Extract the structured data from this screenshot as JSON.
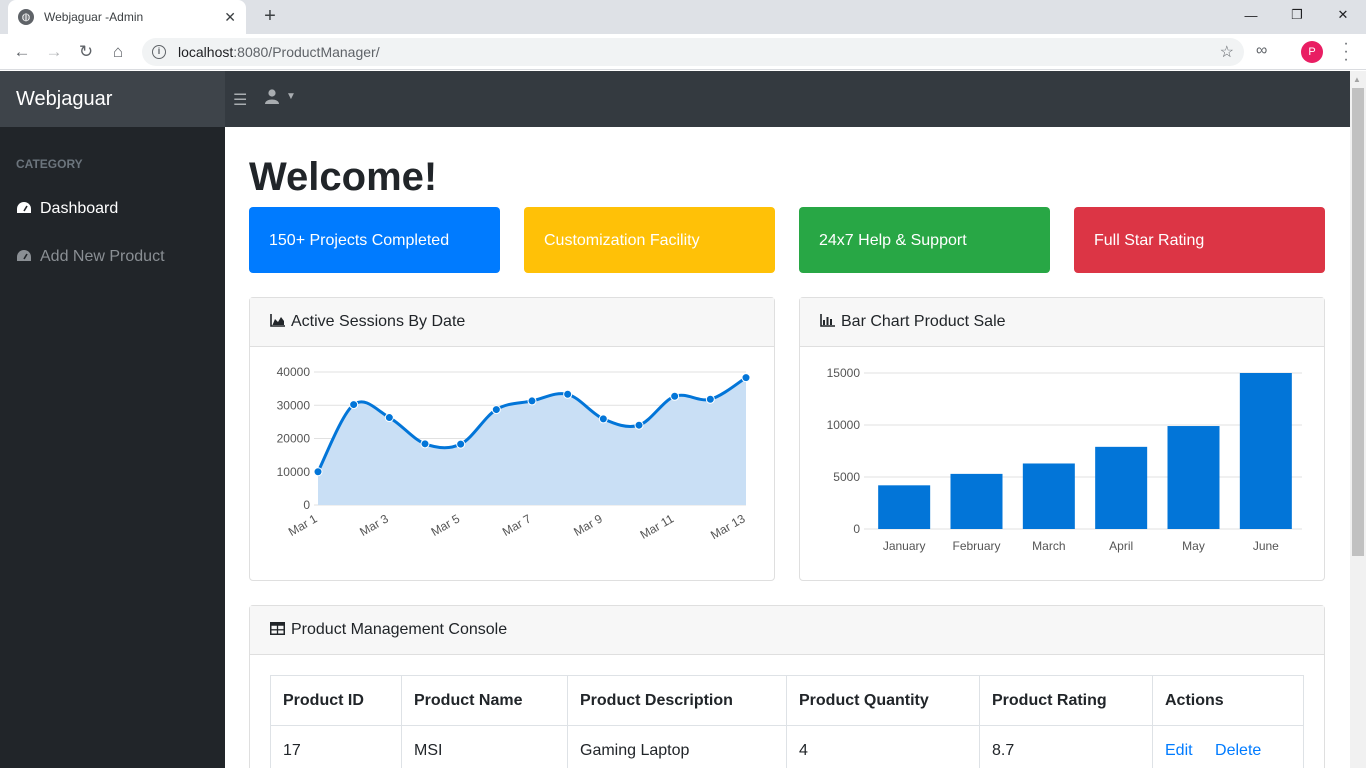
{
  "browser": {
    "tab_title": "Webjaguar -Admin",
    "url_host": "localhost",
    "url_rest": ":8080/ProductManager/",
    "profile_initial": "P"
  },
  "app": {
    "brand": "Webjaguar",
    "sidebar": {
      "heading": "CATEGORY",
      "items": [
        {
          "label": "Dashboard",
          "icon": "tachometer-icon"
        },
        {
          "label": "Add New Product",
          "icon": "tachometer-icon"
        }
      ]
    },
    "welcome": "Welcome!",
    "cards": [
      {
        "label": "150+ Projects Completed",
        "color": "#007bff"
      },
      {
        "label": "Customization Facility",
        "color": "#ffc107"
      },
      {
        "label": "24x7 Help & Support",
        "color": "#28a745"
      },
      {
        "label": "Full Star Rating",
        "color": "#dc3545"
      }
    ],
    "area_panel_title": "Active Sessions By Date",
    "bar_panel_title": "Bar Chart Product Sale",
    "table_panel_title": "Product Management Console",
    "table": {
      "headers": [
        "Product ID",
        "Product Name",
        "Product Description",
        "Product Quantity",
        "Product Rating",
        "Actions"
      ],
      "rows": [
        {
          "id": "17",
          "name": "MSI",
          "description": "Gaming Laptop",
          "quantity": "4",
          "rating": "8.7",
          "edit": "Edit",
          "delete": "Delete"
        }
      ]
    }
  },
  "chart_data": [
    {
      "type": "area",
      "title": "Active Sessions By Date",
      "x": [
        "Mar 1",
        "Mar 2",
        "Mar 3",
        "Mar 4",
        "Mar 5",
        "Mar 6",
        "Mar 7",
        "Mar 8",
        "Mar 9",
        "Mar 10",
        "Mar 11",
        "Mar 12",
        "Mar 13"
      ],
      "x_tick_labels": [
        "Mar 1",
        "Mar 3",
        "Mar 5",
        "Mar 7",
        "Mar 9",
        "Mar 11",
        "Mar 13"
      ],
      "values": [
        10000,
        30200,
        26300,
        18400,
        18300,
        28700,
        31300,
        33300,
        25900,
        24000,
        32700,
        31800,
        38300
      ],
      "y_ticks": [
        0,
        10000,
        20000,
        30000,
        40000
      ],
      "ylim": [
        0,
        40000
      ],
      "color": "#0275d8",
      "fill": "#c9dff5",
      "grid": true
    },
    {
      "type": "bar",
      "title": "Bar Chart Product Sale",
      "categories": [
        "January",
        "February",
        "March",
        "April",
        "May",
        "June"
      ],
      "values": [
        4200,
        5300,
        6300,
        7900,
        9900,
        15000
      ],
      "y_ticks": [
        0,
        5000,
        10000,
        15000
      ],
      "ylim": [
        0,
        15000
      ],
      "color": "#0275d8",
      "grid": true
    }
  ]
}
